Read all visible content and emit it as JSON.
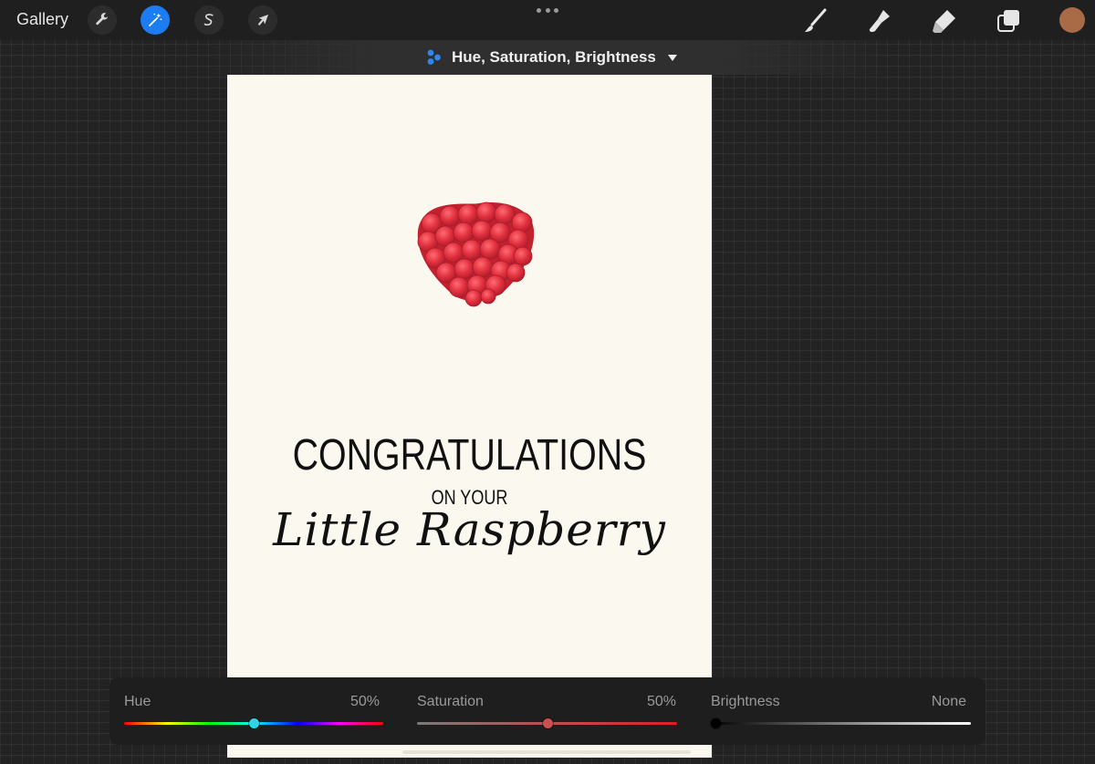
{
  "toolbar": {
    "gallery_label": "Gallery",
    "left_tools": [
      {
        "name": "actions",
        "icon": "wrench-icon"
      },
      {
        "name": "adjustments",
        "icon": "magic-wand-icon",
        "active": true
      },
      {
        "name": "selection",
        "icon": "selection-s-icon"
      },
      {
        "name": "transform",
        "icon": "arrow-cursor-icon"
      }
    ],
    "right_tools": [
      {
        "name": "brush",
        "icon": "brush-icon"
      },
      {
        "name": "smudge",
        "icon": "smudge-icon"
      },
      {
        "name": "eraser",
        "icon": "eraser-icon"
      },
      {
        "name": "layers",
        "icon": "layers-icon"
      }
    ],
    "current_color": "#a86b45",
    "accent_color": "#1c7cf2"
  },
  "adjustment": {
    "title": "Hue, Saturation, Brightness",
    "icon": "hsb-dots-icon",
    "dropdown_icon": "caret-down-icon"
  },
  "canvas": {
    "line1": "CONGRATULATIONS",
    "line2": "ON YOUR",
    "line3": "Little Raspberry",
    "image": "raspberry-illustration"
  },
  "sliders": [
    {
      "label": "Hue",
      "value_text": "50%",
      "position": 0.5
    },
    {
      "label": "Saturation",
      "value_text": "50%",
      "position": 0.5
    },
    {
      "label": "Brightness",
      "value_text": "None",
      "position": 0.0
    }
  ]
}
